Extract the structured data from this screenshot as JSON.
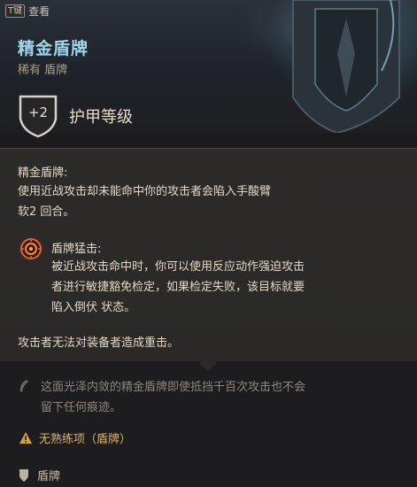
{
  "hotkey": {
    "key": "T键",
    "label": "查看"
  },
  "item": {
    "name": "精金盾牌",
    "rarity_type": "稀有 盾牌",
    "armor_bonus": "+2",
    "armor_label": "护甲等级"
  },
  "property": {
    "title": "精金盾牌:",
    "description_line1": "使用近战攻击却未能命中你的攻击者会陷入手酸臂",
    "description_line2": "软2 回合。"
  },
  "ability": {
    "icon": "shield-bash-icon",
    "name": "盾牌猛击:",
    "description_line1": "被近战攻击命中时，你可以使用反应动作强迫攻击",
    "description_line2": "者进行敏捷豁免检定，如果检定失败，该目标就要",
    "description_line3": "陷入倒伏 状态。"
  },
  "extra_effect": "攻击者无法对装备者造成重击。",
  "flavor": {
    "icon": "feather-icon",
    "line1": "这面光泽内敛的精金盾牌即使抵挡千百次攻击也不会",
    "line2": "留下任何痕迹。"
  },
  "warning": {
    "icon": "warning-icon",
    "text": "无熟练项（盾牌）"
  },
  "item_type": {
    "icon": "shield-icon",
    "label": "盾牌"
  },
  "colors": {
    "title": "#9fd6ee",
    "warning": "#d9b36a",
    "ability_icon": "#e0642c"
  }
}
